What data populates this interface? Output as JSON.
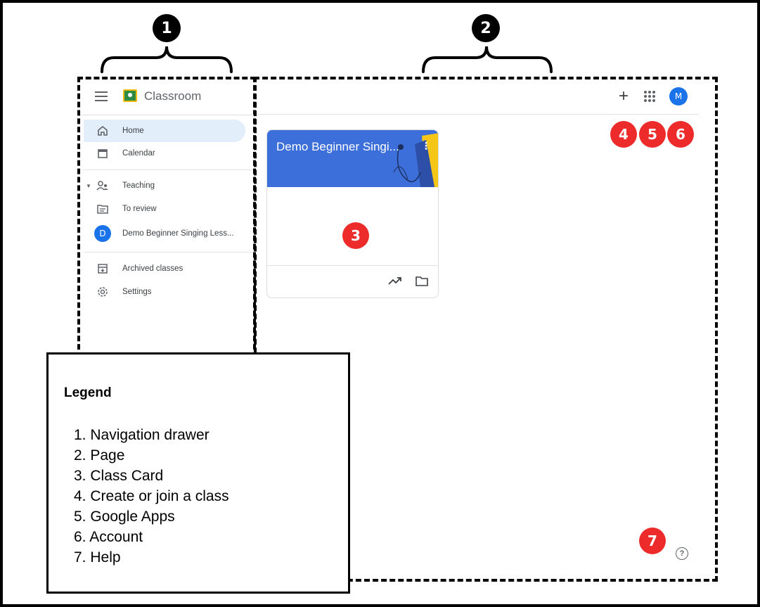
{
  "badges": {
    "drawer": "1",
    "page": "2",
    "card": "3",
    "create": "4",
    "apps": "5",
    "account": "6",
    "help": "7"
  },
  "app": {
    "name": "Classroom"
  },
  "drawer": {
    "items": [
      {
        "label": "Home",
        "icon": "home-icon"
      },
      {
        "label": "Calendar",
        "icon": "calendar-icon"
      },
      {
        "label": "Teaching",
        "icon": "teaching-icon"
      },
      {
        "label": "To review",
        "icon": "review-icon"
      },
      {
        "label": "Demo Beginner Singing Less...",
        "icon": "class-avatar",
        "avatar": "D"
      },
      {
        "label": "Archived classes",
        "icon": "archive-icon"
      },
      {
        "label": "Settings",
        "icon": "settings-icon"
      }
    ]
  },
  "page": {
    "account_initial": "M",
    "card": {
      "title": "Demo Beginner Singi..."
    }
  },
  "legend": {
    "title": "Legend",
    "items": [
      "Navigation drawer",
      "Page",
      "Class Card",
      "Create or join a class",
      "Google Apps",
      "Account",
      "Help"
    ]
  },
  "colors": {
    "badge_red": "#ee2b2b",
    "card_header": "#3c6fd9",
    "active_nav": "#e3eefb",
    "avatar_blue": "#1a73e8"
  }
}
